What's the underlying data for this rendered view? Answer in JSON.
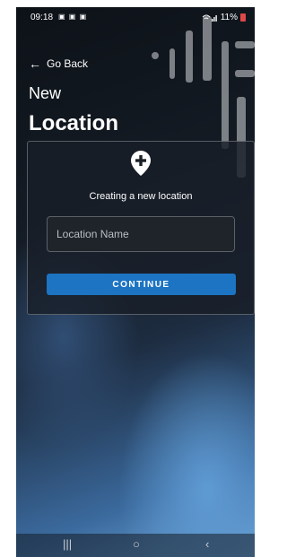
{
  "status_bar": {
    "time": "09:18",
    "notifications": "▣ ▣ ▣",
    "battery": "11%"
  },
  "header": {
    "back_label": "Go Back",
    "title_line1": "New",
    "title_line2": "Location"
  },
  "card": {
    "caption": "Creating a new location",
    "name_placeholder": "Location Name",
    "continue_label": "CONTINUE"
  },
  "nav": {
    "recents": "|||",
    "home": "○",
    "back": "‹"
  },
  "colors": {
    "accent": "#1c74c2",
    "battery": "#e04848"
  }
}
